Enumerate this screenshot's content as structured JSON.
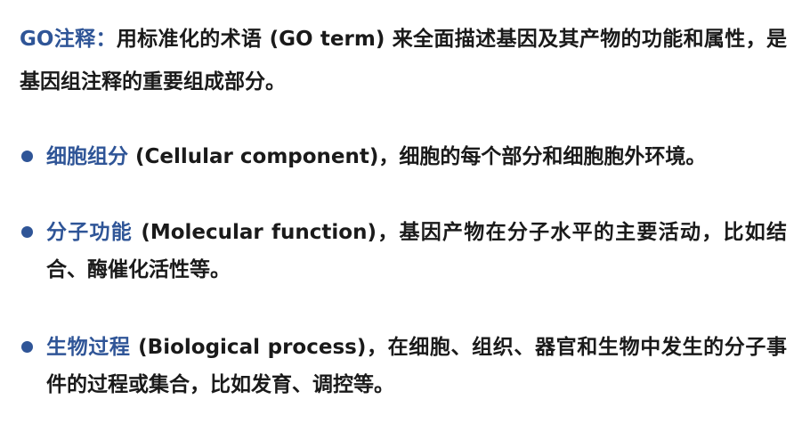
{
  "intro": {
    "term_label": "GO注释：",
    "text": "用标准化的术语 (GO term) 来全面描述基因及其产物的功能和属性，是基因组注释的重要组成部分。"
  },
  "bullets": [
    {
      "term": "细胞组分",
      "text": " (Cellular component)，细胞的每个部分和细胞胞外环境。"
    },
    {
      "term": "分子功能",
      "text": " (Molecular function)，基因产物在分子水平的主要活动，比如结合、酶催化活性等。"
    },
    {
      "term": "生物过程",
      "text": " (Biological process)，在细胞、组织、器官和生物中发生的分子事件的过程或集合，比如发育、调控等。"
    }
  ],
  "colors": {
    "accent": "#2f5597",
    "text": "#1a1a1a"
  }
}
